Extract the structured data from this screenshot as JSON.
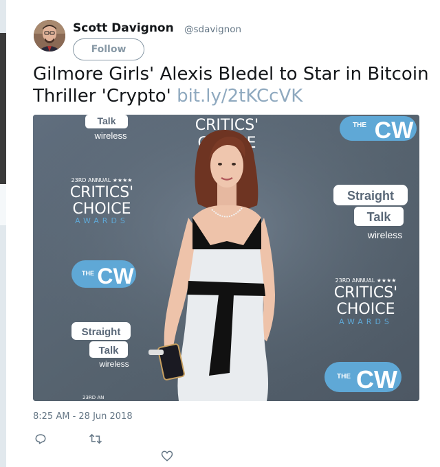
{
  "tweet": {
    "author_name": "Scott Davignon",
    "author_handle": "@sdavignon",
    "follow_label": "Follow",
    "text": "Gilmore Girls' Alexis Bledel to Star in Bitcoin Thriller 'Crypto'",
    "link_text": "bit.ly/2tKCcVK",
    "timestamp": "8:25 AM - 28 Jun 2018"
  },
  "photo": {
    "backdrop_logos": {
      "talk": "Talk",
      "wireless": "wireless",
      "straight": "Straight",
      "the": "THE",
      "annual": "23RD ANNUAL ★★★★",
      "critics": "CRITICS'",
      "choice": "CHOICE",
      "awards": "AWARDS"
    }
  },
  "actions": {
    "reply_icon": "reply-icon",
    "retweet_icon": "retweet-icon",
    "like_icon": "heart-icon"
  },
  "colors": {
    "text": "#14171a",
    "secondary": "#657786",
    "link": "#8fa9bf",
    "backdrop": "#5a6878",
    "cw_blue": "#5fa8d6"
  }
}
